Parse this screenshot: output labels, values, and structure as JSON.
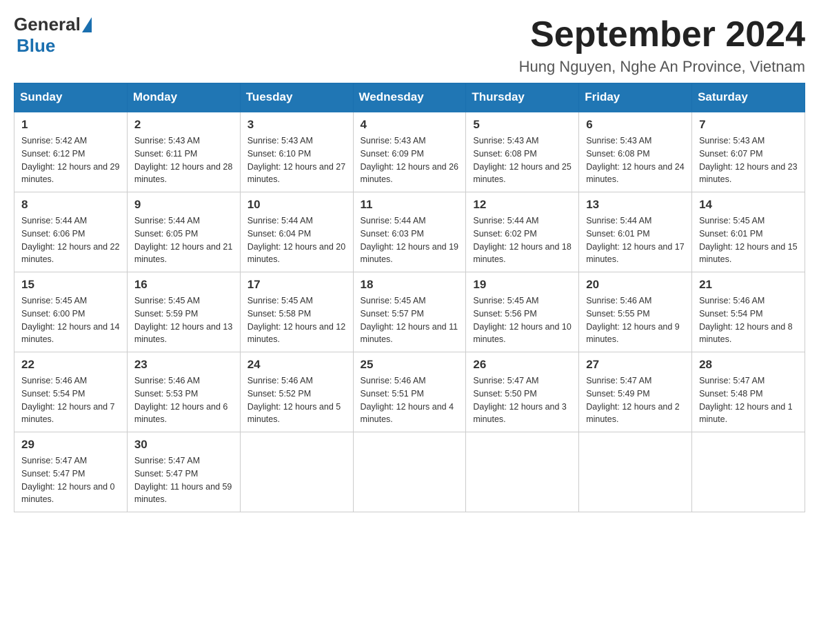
{
  "logo": {
    "general": "General",
    "blue": "Blue"
  },
  "title": "September 2024",
  "location": "Hung Nguyen, Nghe An Province, Vietnam",
  "days_header": [
    "Sunday",
    "Monday",
    "Tuesday",
    "Wednesday",
    "Thursday",
    "Friday",
    "Saturday"
  ],
  "weeks": [
    [
      {
        "day": "1",
        "sunrise": "5:42 AM",
        "sunset": "6:12 PM",
        "daylight": "12 hours and 29 minutes."
      },
      {
        "day": "2",
        "sunrise": "5:43 AM",
        "sunset": "6:11 PM",
        "daylight": "12 hours and 28 minutes."
      },
      {
        "day": "3",
        "sunrise": "5:43 AM",
        "sunset": "6:10 PM",
        "daylight": "12 hours and 27 minutes."
      },
      {
        "day": "4",
        "sunrise": "5:43 AM",
        "sunset": "6:09 PM",
        "daylight": "12 hours and 26 minutes."
      },
      {
        "day": "5",
        "sunrise": "5:43 AM",
        "sunset": "6:08 PM",
        "daylight": "12 hours and 25 minutes."
      },
      {
        "day": "6",
        "sunrise": "5:43 AM",
        "sunset": "6:08 PM",
        "daylight": "12 hours and 24 minutes."
      },
      {
        "day": "7",
        "sunrise": "5:43 AM",
        "sunset": "6:07 PM",
        "daylight": "12 hours and 23 minutes."
      }
    ],
    [
      {
        "day": "8",
        "sunrise": "5:44 AM",
        "sunset": "6:06 PM",
        "daylight": "12 hours and 22 minutes."
      },
      {
        "day": "9",
        "sunrise": "5:44 AM",
        "sunset": "6:05 PM",
        "daylight": "12 hours and 21 minutes."
      },
      {
        "day": "10",
        "sunrise": "5:44 AM",
        "sunset": "6:04 PM",
        "daylight": "12 hours and 20 minutes."
      },
      {
        "day": "11",
        "sunrise": "5:44 AM",
        "sunset": "6:03 PM",
        "daylight": "12 hours and 19 minutes."
      },
      {
        "day": "12",
        "sunrise": "5:44 AM",
        "sunset": "6:02 PM",
        "daylight": "12 hours and 18 minutes."
      },
      {
        "day": "13",
        "sunrise": "5:44 AM",
        "sunset": "6:01 PM",
        "daylight": "12 hours and 17 minutes."
      },
      {
        "day": "14",
        "sunrise": "5:45 AM",
        "sunset": "6:01 PM",
        "daylight": "12 hours and 15 minutes."
      }
    ],
    [
      {
        "day": "15",
        "sunrise": "5:45 AM",
        "sunset": "6:00 PM",
        "daylight": "12 hours and 14 minutes."
      },
      {
        "day": "16",
        "sunrise": "5:45 AM",
        "sunset": "5:59 PM",
        "daylight": "12 hours and 13 minutes."
      },
      {
        "day": "17",
        "sunrise": "5:45 AM",
        "sunset": "5:58 PM",
        "daylight": "12 hours and 12 minutes."
      },
      {
        "day": "18",
        "sunrise": "5:45 AM",
        "sunset": "5:57 PM",
        "daylight": "12 hours and 11 minutes."
      },
      {
        "day": "19",
        "sunrise": "5:45 AM",
        "sunset": "5:56 PM",
        "daylight": "12 hours and 10 minutes."
      },
      {
        "day": "20",
        "sunrise": "5:46 AM",
        "sunset": "5:55 PM",
        "daylight": "12 hours and 9 minutes."
      },
      {
        "day": "21",
        "sunrise": "5:46 AM",
        "sunset": "5:54 PM",
        "daylight": "12 hours and 8 minutes."
      }
    ],
    [
      {
        "day": "22",
        "sunrise": "5:46 AM",
        "sunset": "5:54 PM",
        "daylight": "12 hours and 7 minutes."
      },
      {
        "day": "23",
        "sunrise": "5:46 AM",
        "sunset": "5:53 PM",
        "daylight": "12 hours and 6 minutes."
      },
      {
        "day": "24",
        "sunrise": "5:46 AM",
        "sunset": "5:52 PM",
        "daylight": "12 hours and 5 minutes."
      },
      {
        "day": "25",
        "sunrise": "5:46 AM",
        "sunset": "5:51 PM",
        "daylight": "12 hours and 4 minutes."
      },
      {
        "day": "26",
        "sunrise": "5:47 AM",
        "sunset": "5:50 PM",
        "daylight": "12 hours and 3 minutes."
      },
      {
        "day": "27",
        "sunrise": "5:47 AM",
        "sunset": "5:49 PM",
        "daylight": "12 hours and 2 minutes."
      },
      {
        "day": "28",
        "sunrise": "5:47 AM",
        "sunset": "5:48 PM",
        "daylight": "12 hours and 1 minute."
      }
    ],
    [
      {
        "day": "29",
        "sunrise": "5:47 AM",
        "sunset": "5:47 PM",
        "daylight": "12 hours and 0 minutes."
      },
      {
        "day": "30",
        "sunrise": "5:47 AM",
        "sunset": "5:47 PM",
        "daylight": "11 hours and 59 minutes."
      },
      null,
      null,
      null,
      null,
      null
    ]
  ]
}
